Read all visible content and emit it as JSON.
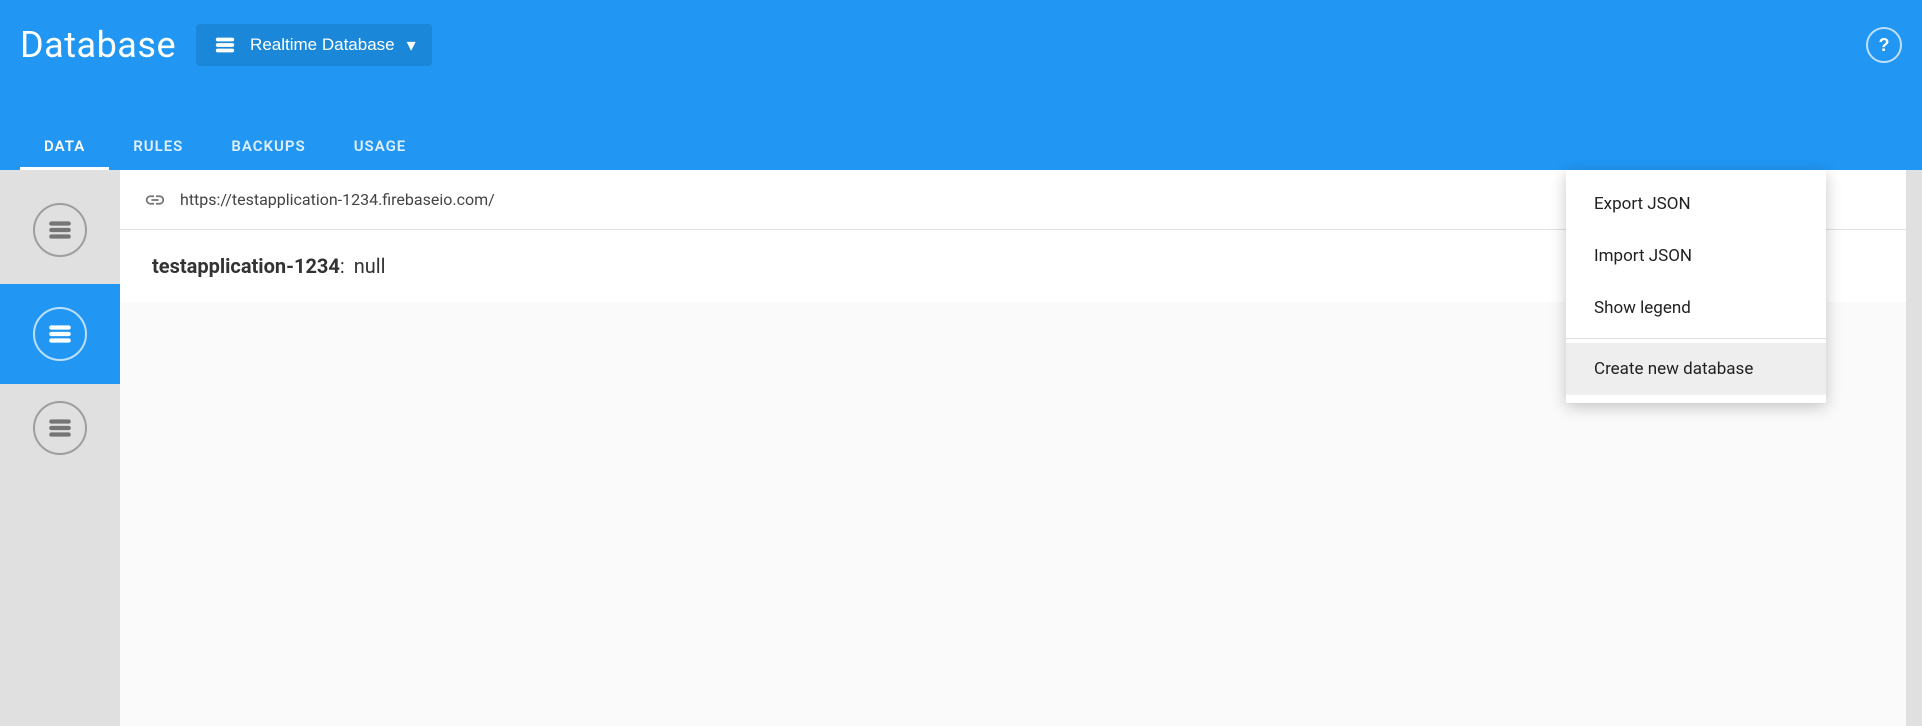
{
  "header": {
    "title": "Database",
    "db_selector_label": "Realtime Database",
    "help_label": "?"
  },
  "nav": {
    "tabs": [
      {
        "label": "DATA",
        "active": true
      },
      {
        "label": "RULES",
        "active": false
      },
      {
        "label": "BACKUPS",
        "active": false
      },
      {
        "label": "USAGE",
        "active": false
      }
    ]
  },
  "url_bar": {
    "url": "https://testapplication-1234.firebaseio.com/"
  },
  "db_entry": {
    "key": "testapplication-1234",
    "value": "null"
  },
  "dropdown": {
    "items": [
      {
        "label": "Export JSON",
        "highlighted": false
      },
      {
        "label": "Import JSON",
        "highlighted": false
      },
      {
        "label": "Show legend",
        "highlighted": false
      },
      {
        "label": "Create new database",
        "highlighted": true
      }
    ]
  },
  "sidebar": {
    "items": [
      {
        "active": false
      },
      {
        "active": true
      },
      {
        "active": false
      }
    ]
  }
}
